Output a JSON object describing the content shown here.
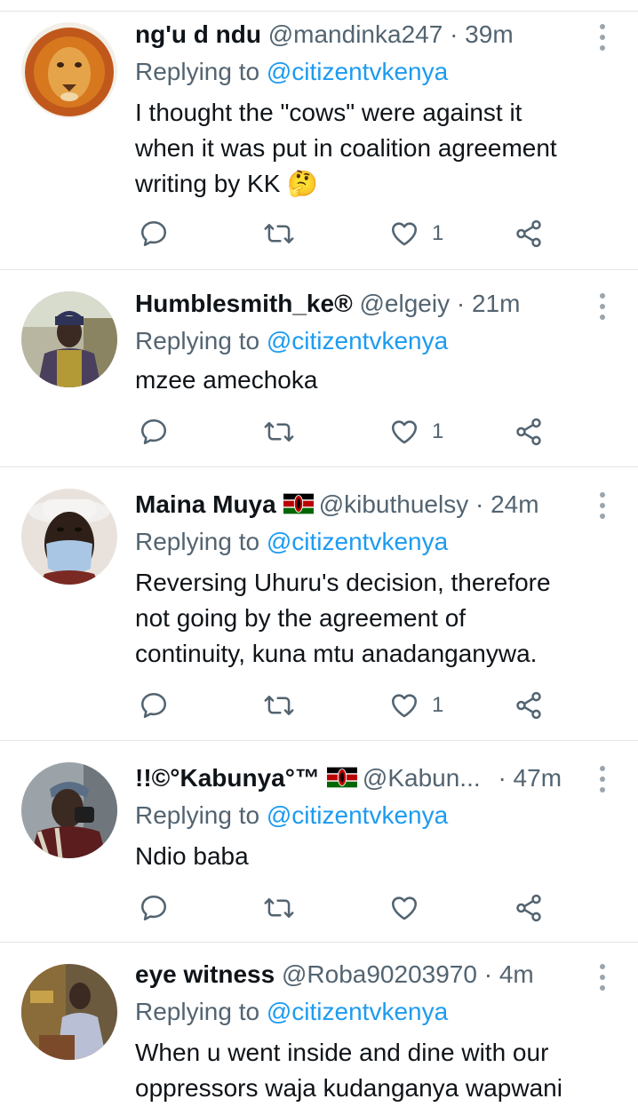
{
  "colors": {
    "link": "#1d9bf0",
    "muted": "#536471",
    "text": "#0f1419",
    "divider": "#e1e6ea"
  },
  "tweets": [
    {
      "name": "ng'u d ndu",
      "handle": "@mandinka247",
      "dot": "·",
      "time": "39m",
      "reply_prefix": "Replying to",
      "reply_to": "@citizentvkenya",
      "text_lines": [
        "I thought the \"cows\" were against it",
        "when it was put in coalition agreement",
        "writing by KK 🤔"
      ],
      "like_count": "1",
      "avatar": "lion-avatar"
    },
    {
      "name": "Humblesmith_ke®",
      "handle": "@elgeiy",
      "dot": "·",
      "time": "21m",
      "reply_prefix": "Replying to",
      "reply_to": "@citizentvkenya",
      "text_lines": [
        "mzee amechoka"
      ],
      "like_count": "1",
      "avatar": "person-avatar"
    },
    {
      "name": "Maina Muya",
      "handle": "@kibuthuelsy",
      "dot": "·",
      "time": "24m",
      "reply_prefix": "Replying to",
      "reply_to": "@citizentvkenya",
      "text_lines": [
        "Reversing Uhuru's decision, therefore",
        "not going by the agreement of",
        "continuity, kuna mtu anadanganywa."
      ],
      "like_count": "1",
      "avatar": "masked-person-avatar"
    },
    {
      "name": "!!©°Kabunya°™",
      "handle": "@Kabun...",
      "dot": "·",
      "time": "47m",
      "reply_prefix": "Replying to",
      "reply_to": "@citizentvkenya",
      "text_lines": [
        "Ndio baba"
      ],
      "like_count": "",
      "avatar": "elder-avatar"
    },
    {
      "name": "eye witness",
      "handle": "@Roba90203970",
      "dot": "·",
      "time": "4m",
      "reply_prefix": "Replying to",
      "reply_to": "@citizentvkenya",
      "text_lines": [
        "When u went inside and dine with our",
        "oppressors waja kudanganya wapwani"
      ],
      "like_count": "",
      "avatar": "seated-person-avatar"
    }
  ]
}
